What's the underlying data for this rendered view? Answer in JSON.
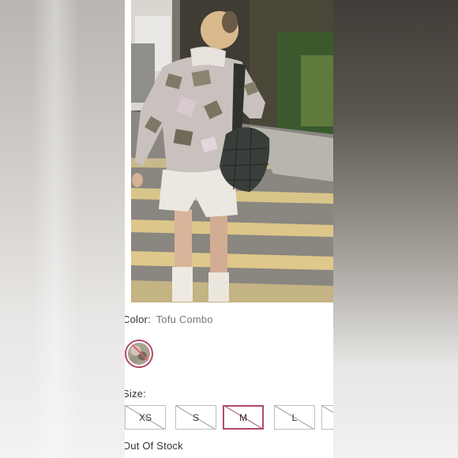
{
  "product": {
    "color_label": "Color:",
    "color_value": "Tofu Combo",
    "size_label": "Size:",
    "sizes": [
      {
        "label": "XS",
        "available": false,
        "selected": false
      },
      {
        "label": "S",
        "available": false,
        "selected": false
      },
      {
        "label": "M",
        "available": false,
        "selected": true
      },
      {
        "label": "L",
        "available": false,
        "selected": false
      },
      {
        "label": "",
        "available": false,
        "selected": false
      }
    ],
    "stock_status": "Out Of Stock"
  },
  "colors": {
    "accent": "#b04a6a",
    "text": "#333333",
    "muted": "#777777"
  }
}
